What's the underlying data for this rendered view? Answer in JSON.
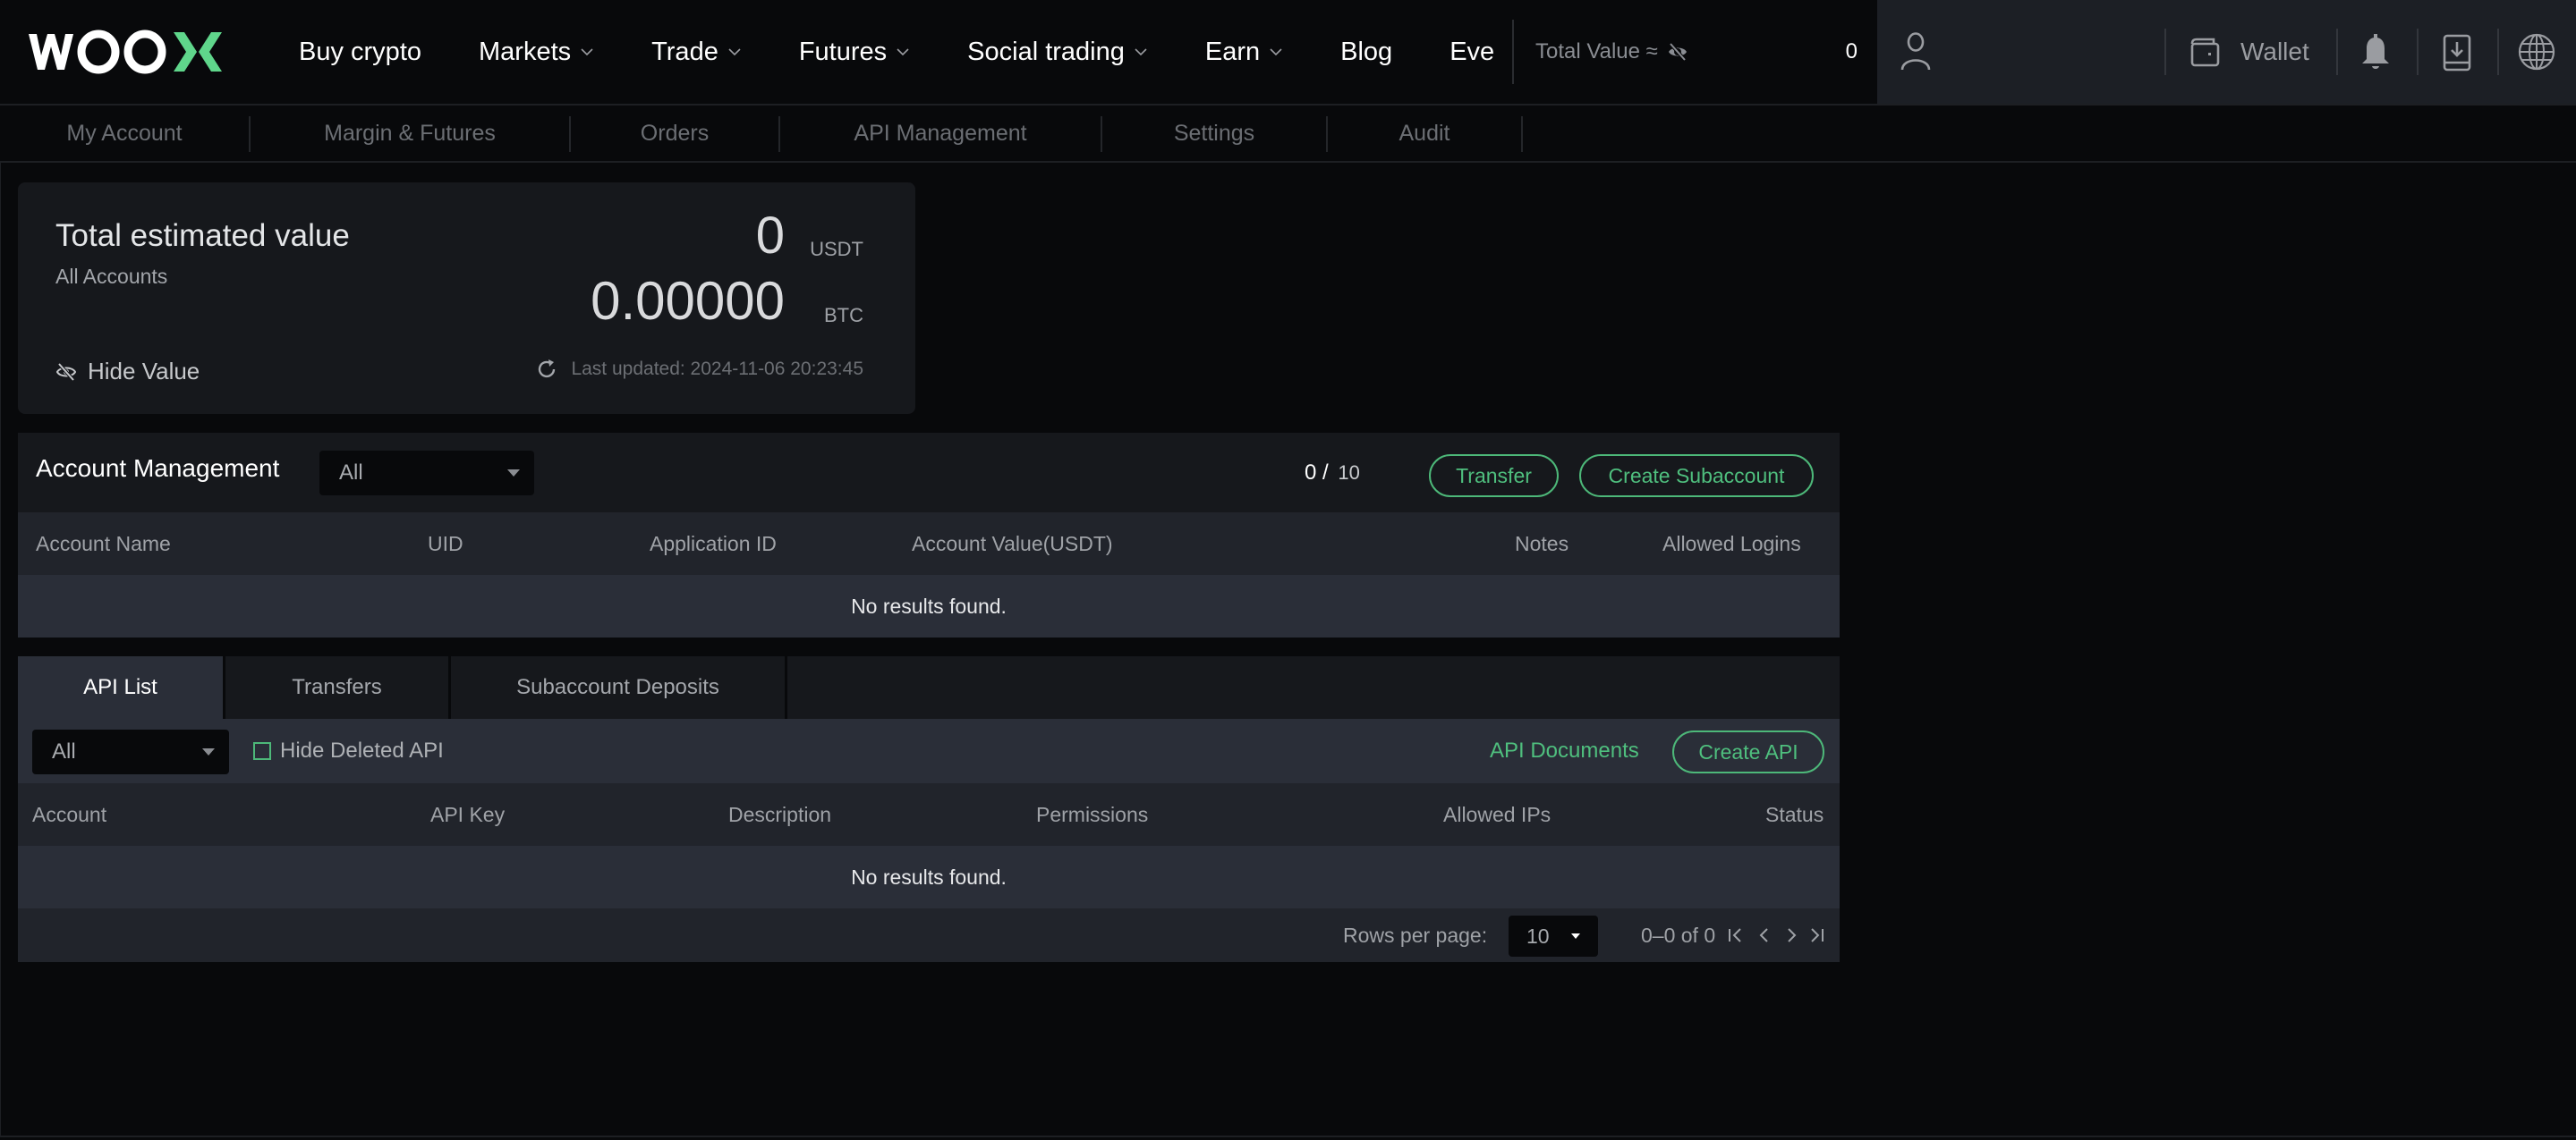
{
  "header": {
    "brand": "WOOX",
    "nav": [
      {
        "label": "Buy crypto",
        "has_dropdown": false
      },
      {
        "label": "Markets",
        "has_dropdown": true
      },
      {
        "label": "Trade",
        "has_dropdown": true
      },
      {
        "label": "Futures",
        "has_dropdown": true
      },
      {
        "label": "Social trading",
        "has_dropdown": true
      },
      {
        "label": "Earn",
        "has_dropdown": true
      },
      {
        "label": "Blog",
        "has_dropdown": false
      },
      {
        "label": "Eve",
        "has_dropdown": false
      }
    ],
    "total_value_label": "Total Value ≈",
    "total_value": "0",
    "wallet_label": "Wallet",
    "icons": [
      "user-icon",
      "wallet-icon",
      "bell-icon",
      "download-app-icon",
      "globe-icon"
    ]
  },
  "subnav": {
    "tabs": [
      "My Account",
      "Margin & Futures",
      "Orders",
      "API Management",
      "Settings",
      "Audit"
    ]
  },
  "value_card": {
    "title": "Total estimated value",
    "subtitle": "All Accounts",
    "usdt_value": "0",
    "usdt_unit": "USDT",
    "btc_value": "0.00000",
    "btc_unit": "BTC",
    "hide_value_label": "Hide Value",
    "last_updated": "Last updated: 2024-11-06 20:23:45"
  },
  "account_management": {
    "title": "Account Management",
    "filter_value": "All",
    "count_used": "0",
    "count_sep": " / ",
    "count_total": "10",
    "transfer_label": "Transfer",
    "create_subaccount_label": "Create Subaccount",
    "columns": [
      "Account Name",
      "UID",
      "Application ID",
      "Account Value(USDT)",
      "Notes",
      "Allowed Logins"
    ],
    "rows": [],
    "empty_text": "No results found."
  },
  "api_section": {
    "tabs": [
      {
        "label": "API List",
        "active": true
      },
      {
        "label": "Transfers",
        "active": false
      },
      {
        "label": "Subaccount Deposits",
        "active": false
      }
    ],
    "filter_value": "All",
    "hide_deleted_label": "Hide Deleted API",
    "hide_deleted_checked": false,
    "api_docs_label": "API Documents",
    "create_api_label": "Create API",
    "columns": [
      "Account",
      "API Key",
      "Description",
      "Permissions",
      "Allowed IPs",
      "Status"
    ],
    "rows": [],
    "empty_text": "No results found.",
    "rows_per_page_label": "Rows per page:",
    "rows_per_page": "10",
    "page_info": "0–0 of 0"
  },
  "colors": {
    "accent": "#4fbf7e",
    "background": "#08090b",
    "panel": "#16181c",
    "table_header": "#21242b",
    "table_row": "#2a2e38"
  }
}
